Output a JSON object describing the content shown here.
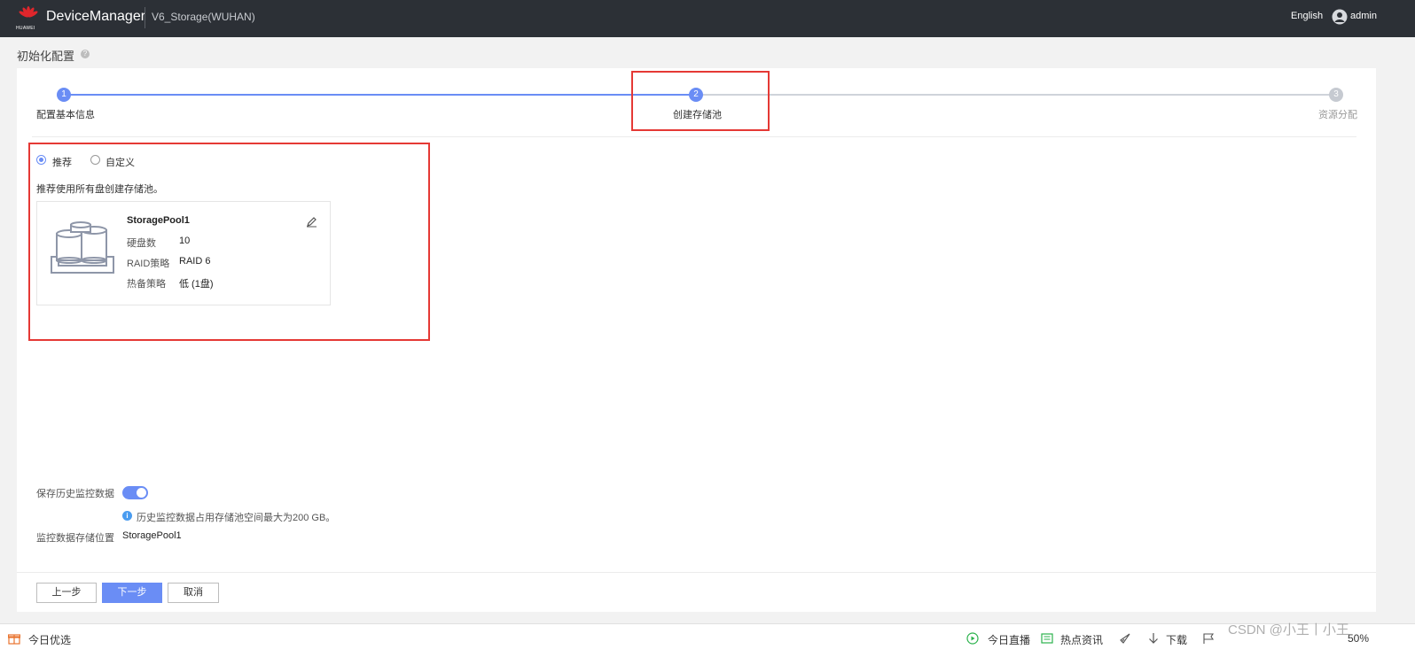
{
  "header": {
    "brand_text": "HUAWEI",
    "app_title": "DeviceManager",
    "device_name": "V6_Storage(WUHAN)",
    "language": "English",
    "user": "admin"
  },
  "page": {
    "title": "初始化配置",
    "help": "?"
  },
  "stepper": {
    "steps": [
      {
        "num": "1",
        "label": "配置基本信息",
        "state": "done"
      },
      {
        "num": "2",
        "label": "创建存储池",
        "state": "current"
      },
      {
        "num": "3",
        "label": "资源分配",
        "state": "pending"
      }
    ]
  },
  "mode": {
    "options": [
      "推荐",
      "自定义"
    ],
    "selected": "推荐",
    "hint": "推荐使用所有盘创建存储池。"
  },
  "pool": {
    "name": "StoragePool1",
    "rows": [
      {
        "key": "硬盘数",
        "value": "10"
      },
      {
        "key": "RAID策略",
        "value": "RAID 6"
      },
      {
        "key": "热备策略",
        "value": "低 (1盘)"
      }
    ]
  },
  "monitoring": {
    "save_history_label": "保存历史监控数据",
    "save_history_on": true,
    "info": "历史监控数据占用存储池空间最大为200 GB。",
    "location_label": "监控数据存储位置",
    "location_value": "StoragePool1"
  },
  "actions": {
    "prev": "上一步",
    "next": "下一步",
    "cancel": "取消"
  },
  "taskbar": {
    "left": "今日优选",
    "items": [
      "今日直播",
      "热点资讯",
      "下载"
    ],
    "percent": "50%"
  },
  "watermark": "CSDN @小王丨小王",
  "colors": {
    "accent": "#6a8df5",
    "topbar": "#2c3036",
    "highlight": "#e53935"
  }
}
